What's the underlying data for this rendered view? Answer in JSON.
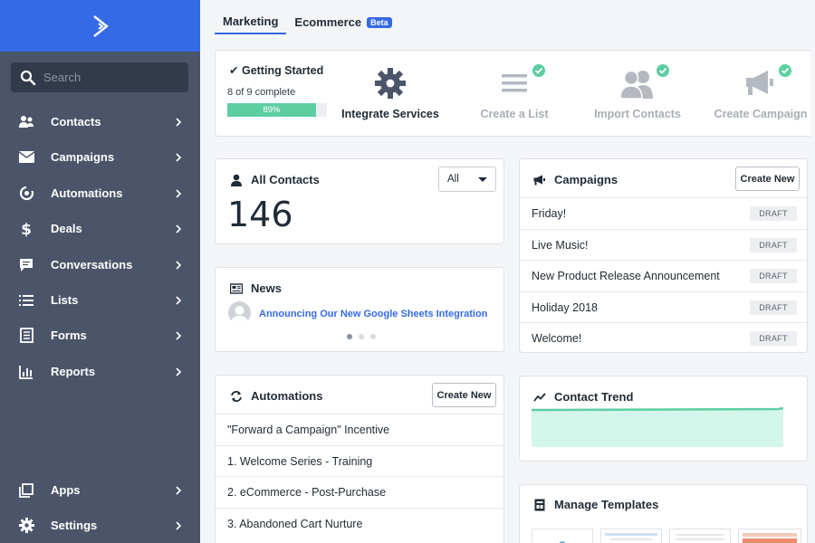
{
  "sidebar": {
    "search_placeholder": "Search",
    "items": [
      {
        "label": "Contacts",
        "icon": "contacts-icon"
      },
      {
        "label": "Campaigns",
        "icon": "envelope-icon"
      },
      {
        "label": "Automations",
        "icon": "automations-icon"
      },
      {
        "label": "Deals",
        "icon": "dollar-icon"
      },
      {
        "label": "Conversations",
        "icon": "chat-icon"
      },
      {
        "label": "Lists",
        "icon": "list-icon"
      },
      {
        "label": "Forms",
        "icon": "form-icon"
      },
      {
        "label": "Reports",
        "icon": "bar-chart-icon"
      }
    ],
    "bottom_items": [
      {
        "label": "Apps",
        "icon": "apps-icon"
      },
      {
        "label": "Settings",
        "icon": "gear-icon"
      }
    ]
  },
  "tabs": [
    {
      "label": "Marketing",
      "active": true
    },
    {
      "label": "Ecommerce",
      "badge": "Beta"
    }
  ],
  "getting_started": {
    "title": "Getting Started",
    "progress_text": "8 of 9 complete",
    "progress_label": "89%",
    "progress": 0.89,
    "steps": [
      {
        "label": "Integrate Services",
        "done": false,
        "icon": "gear-icon"
      },
      {
        "label": "Create a List",
        "done": true,
        "icon": "list-icon"
      },
      {
        "label": "Import Contacts",
        "done": true,
        "icon": "users-icon"
      },
      {
        "label": "Create Campaign",
        "done": true,
        "icon": "megaphone-icon"
      }
    ]
  },
  "contacts": {
    "title": "All Contacts",
    "filter": "All",
    "count": "146"
  },
  "news": {
    "title": "News",
    "headline": "Announcing Our New Google Sheets Integration"
  },
  "campaigns": {
    "title": "Campaigns",
    "create_label": "Create New",
    "items": [
      {
        "name": "Friday!",
        "status": "DRAFT"
      },
      {
        "name": "Live Music!",
        "status": "DRAFT"
      },
      {
        "name": "New Product Release Announcement",
        "status": "DRAFT"
      },
      {
        "name": "Holiday 2018",
        "status": "DRAFT"
      },
      {
        "name": "Welcome!",
        "status": "DRAFT"
      }
    ]
  },
  "automations": {
    "title": "Automations",
    "create_label": "Create New",
    "items": [
      "\"Forward a Campaign\" Incentive",
      "1. Welcome Series - Training",
      "2. eCommerce - Post-Purchase",
      "3. Abandoned Cart Nurture"
    ]
  },
  "contact_trend": {
    "title": "Contact Trend"
  },
  "templates": {
    "title": "Manage Templates"
  },
  "colors": {
    "brand": "#356ae6",
    "sidebar": "#4b5468",
    "success": "#5dcea2"
  }
}
